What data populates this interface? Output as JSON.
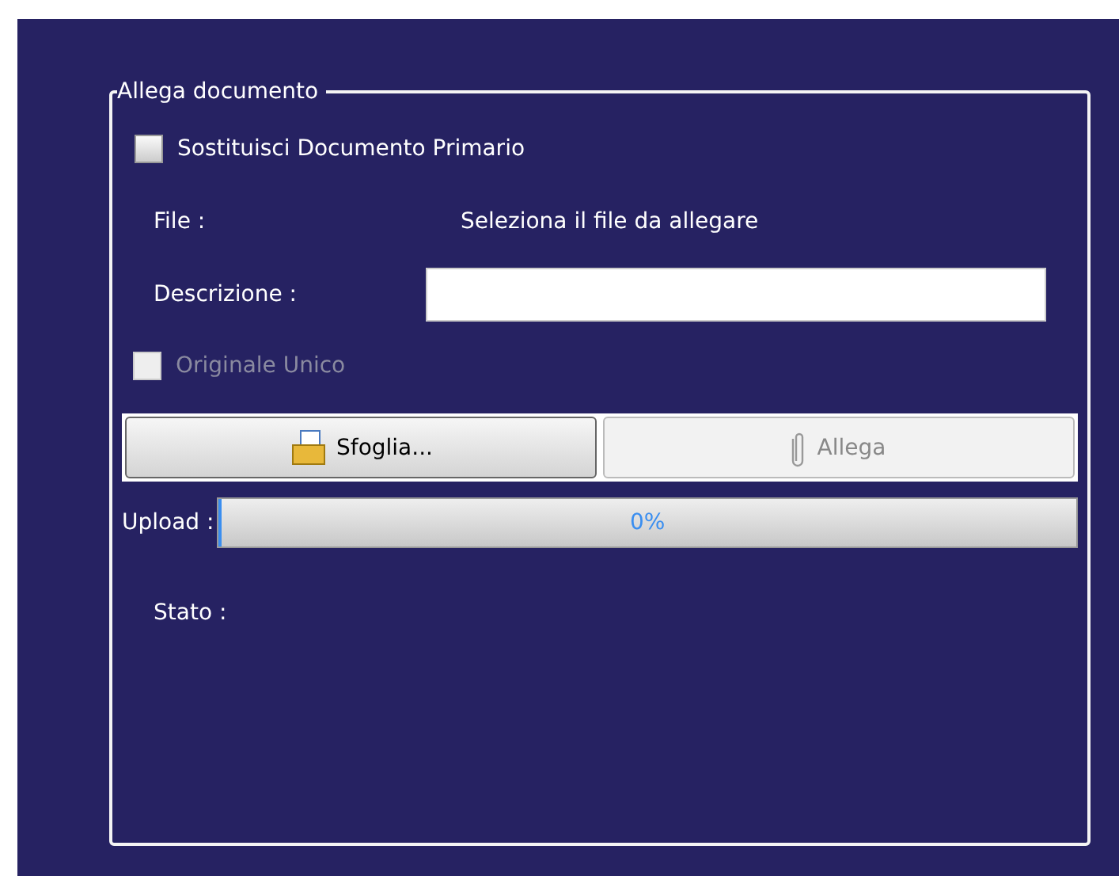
{
  "group": {
    "title": "Allega documento"
  },
  "replace_primary": {
    "label": "Sostituisci Documento Primario",
    "checked": false,
    "disabled": false
  },
  "file": {
    "label": "File :",
    "value": "Seleziona il file da allegare"
  },
  "description": {
    "label": "Descrizione :"
  },
  "unique_original": {
    "label": "Originale Unico",
    "checked": false,
    "disabled": true
  },
  "buttons": [
    {
      "label": "Sfoglia...",
      "kind": "browse",
      "disabled": false
    },
    {
      "label": "Allega",
      "kind": "attach",
      "disabled": true
    }
  ],
  "upload": {
    "label": "Upload :",
    "level": 0,
    "reading": "0%"
  },
  "status": {
    "label": "Stato :"
  }
}
